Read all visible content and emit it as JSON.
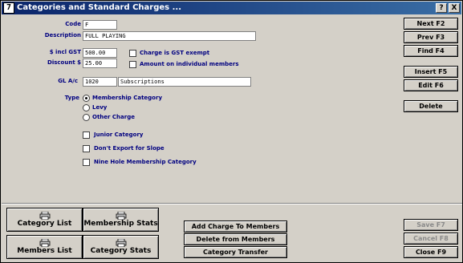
{
  "window": {
    "icon_label": "7",
    "title": "Categories and Standard Charges ...",
    "help_btn": "?",
    "close_btn": "X"
  },
  "form": {
    "code": {
      "label": "Code",
      "value": "F"
    },
    "description": {
      "label": "Description",
      "value": "FULL PLAYING"
    },
    "incl_gst": {
      "label": "$ incl GST",
      "value": "500.00"
    },
    "discount": {
      "label": "Discount $",
      "value": "25.00"
    },
    "gst_exempt": {
      "label": "Charge is GST exempt",
      "checked": false
    },
    "amount_individual": {
      "label": "Amount on individual members",
      "checked": false
    },
    "gl_ac": {
      "label": "GL A/c",
      "code": "1020",
      "name": "Subscriptions"
    },
    "type": {
      "label": "Type",
      "options": [
        "Membership Category",
        "Levy",
        "Other Charge"
      ],
      "selected": "Membership Category"
    },
    "junior": {
      "label": "Junior Category",
      "checked": false
    },
    "dont_export": {
      "label": "Don't Export for Slope",
      "checked": false
    },
    "nine_hole": {
      "label": "Nine Hole Membership Category",
      "checked": false
    }
  },
  "side_buttons": {
    "next": "Next F2",
    "prev": "Prev F3",
    "find": "Find F4",
    "insert": "Insert F5",
    "edit": "Edit F6",
    "delete": "Delete",
    "save": "Save F7",
    "cancel": "Cancel F8",
    "close": "Close F9"
  },
  "bottom": {
    "category_list": "Category List",
    "membership_stats": "Membership Stats",
    "members_list": "Members List",
    "category_stats": "Category Stats",
    "add_charge": "Add Charge To Members",
    "delete_from": "Delete from Members",
    "category_transfer": "Category Transfer"
  }
}
